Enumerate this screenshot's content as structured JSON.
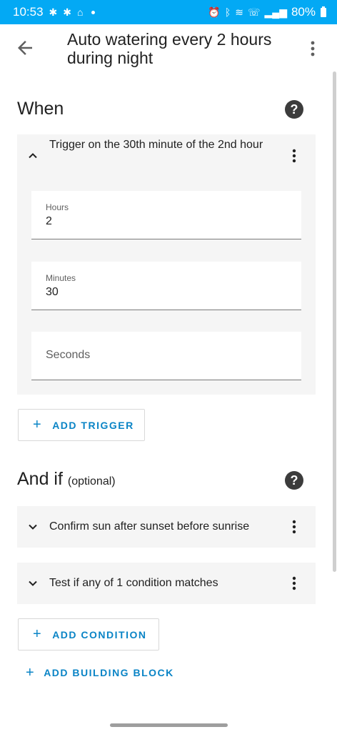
{
  "status_bar": {
    "time": "10:53",
    "battery": "80%"
  },
  "app_bar": {
    "title": "Auto watering every 2 hours during night"
  },
  "when": {
    "heading": "When",
    "trigger": {
      "title": "Trigger on the 30th minute of the 2nd hour",
      "fields": [
        {
          "label": "Hours",
          "value": "2"
        },
        {
          "label": "Minutes",
          "value": "30"
        },
        {
          "placeholder": "Seconds"
        }
      ]
    },
    "add_trigger_label": "ADD TRIGGER"
  },
  "and_if": {
    "heading": "And if",
    "optional_label": "(optional)",
    "conditions": [
      {
        "title": "Confirm sun after sunset before sunrise"
      },
      {
        "title": "Test if any of 1 condition matches"
      }
    ],
    "add_condition_label": "ADD CONDITION",
    "add_building_block_label": "ADD BUILDING BLOCK"
  },
  "colors": {
    "status_bar": "#03a9f4",
    "accent": "#0a84c6",
    "card_bg": "#f5f5f5"
  }
}
